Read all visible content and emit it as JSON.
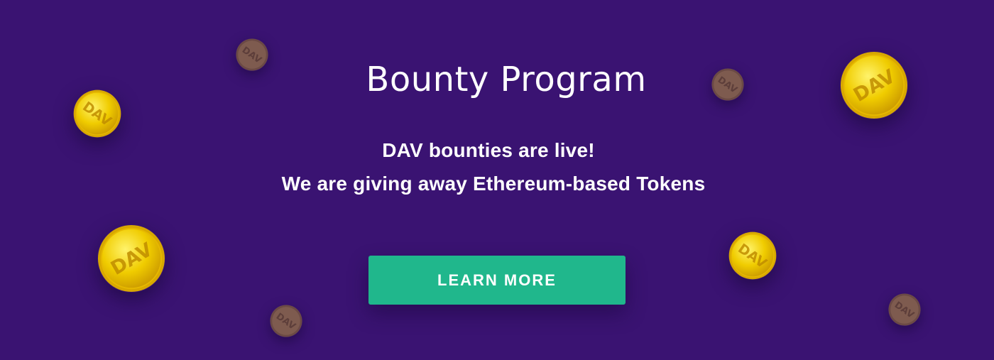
{
  "banner": {
    "title": "Bounty Program",
    "line1": "DAV bounties are live!",
    "line2": "We are giving away Ethereum-based Tokens",
    "cta_label": "LEARN MORE",
    "coin_text": "DAV"
  },
  "colors": {
    "background": "#3a1372",
    "button": "#20b78c",
    "text": "#ffffff",
    "gold_coin": "#f3d400",
    "bronze_coin": "#7d5a4d"
  }
}
